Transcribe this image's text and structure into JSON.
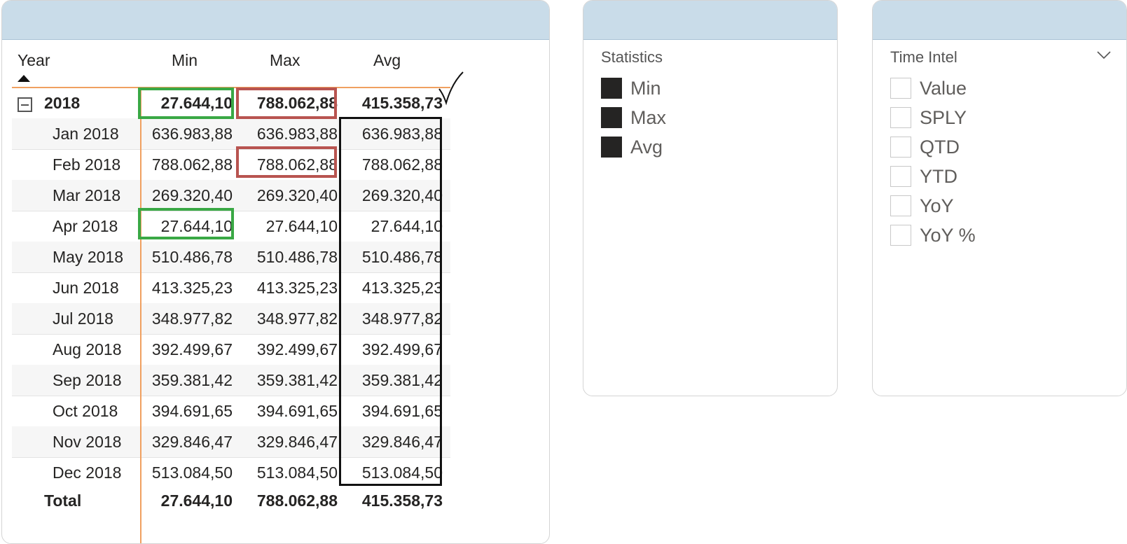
{
  "matrix": {
    "headers": {
      "year": "Year",
      "min": "Min",
      "max": "Max",
      "avg": "Avg"
    },
    "year_row": {
      "label": "2018",
      "min": "27.644,10",
      "max": "788.062,88",
      "avg": "415.358,73"
    },
    "months": [
      {
        "label": "Jan 2018",
        "min": "636.983,88",
        "max": "636.983,88",
        "avg": "636.983,88"
      },
      {
        "label": "Feb 2018",
        "min": "788.062,88",
        "max": "788.062,88",
        "avg": "788.062,88"
      },
      {
        "label": "Mar 2018",
        "min": "269.320,40",
        "max": "269.320,40",
        "avg": "269.320,40"
      },
      {
        "label": "Apr 2018",
        "min": "27.644,10",
        "max": "27.644,10",
        "avg": "27.644,10"
      },
      {
        "label": "May 2018",
        "min": "510.486,78",
        "max": "510.486,78",
        "avg": "510.486,78"
      },
      {
        "label": "Jun 2018",
        "min": "413.325,23",
        "max": "413.325,23",
        "avg": "413.325,23"
      },
      {
        "label": "Jul 2018",
        "min": "348.977,82",
        "max": "348.977,82",
        "avg": "348.977,82"
      },
      {
        "label": "Aug 2018",
        "min": "392.499,67",
        "max": "392.499,67",
        "avg": "392.499,67"
      },
      {
        "label": "Sep 2018",
        "min": "359.381,42",
        "max": "359.381,42",
        "avg": "359.381,42"
      },
      {
        "label": "Oct 2018",
        "min": "394.691,65",
        "max": "394.691,65",
        "avg": "394.691,65"
      },
      {
        "label": "Nov 2018",
        "min": "329.846,47",
        "max": "329.846,47",
        "avg": "329.846,47"
      },
      {
        "label": "Dec 2018",
        "min": "513.084,50",
        "max": "513.084,50",
        "avg": "513.084,50"
      }
    ],
    "total_row": {
      "label": "Total",
      "min": "27.644,10",
      "max": "788.062,88",
      "avg": "415.358,73"
    },
    "sort": "ascending",
    "highlight_colors": {
      "min": "#3aa845",
      "max": "#b85450",
      "avg": "#111111",
      "accent": "#f0a060"
    }
  },
  "statistics_slicer": {
    "title": "Statistics",
    "items": [
      {
        "label": "Min",
        "checked": true
      },
      {
        "label": "Max",
        "checked": true
      },
      {
        "label": "Avg",
        "checked": true
      }
    ]
  },
  "time_intel_slicer": {
    "title": "Time Intel",
    "items": [
      {
        "label": "Value",
        "checked": false
      },
      {
        "label": "SPLY",
        "checked": false
      },
      {
        "label": "QTD",
        "checked": false
      },
      {
        "label": "YTD",
        "checked": false
      },
      {
        "label": "YoY",
        "checked": false
      },
      {
        "label": "YoY %",
        "checked": false
      }
    ]
  }
}
